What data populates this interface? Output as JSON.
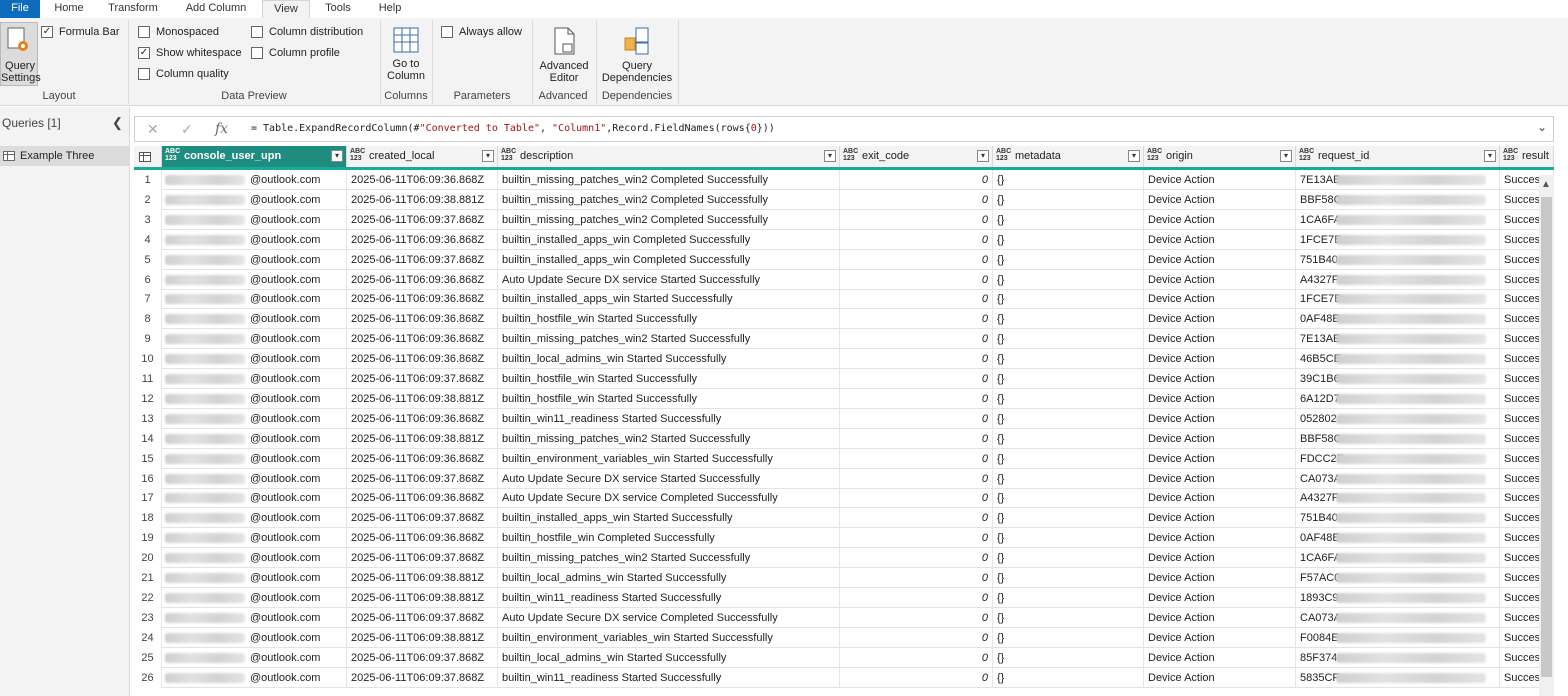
{
  "menu": {
    "tabs": [
      "File",
      "Home",
      "Transform",
      "Add Column",
      "View",
      "Tools",
      "Help"
    ],
    "active": "View"
  },
  "ribbon": {
    "layout": {
      "query_settings_line1": "Query",
      "query_settings_line2": "Settings",
      "formula_bar": "Formula Bar",
      "formula_bar_checked": true,
      "label": "Layout"
    },
    "data_preview": {
      "monospaced": "Monospaced",
      "show_whitespace": "Show whitespace",
      "column_quality": "Column quality",
      "column_distribution": "Column distribution",
      "column_profile": "Column profile",
      "label": "Data Preview"
    },
    "columns": {
      "go_to_column_line1": "Go to",
      "go_to_column_line2": "Column",
      "label": "Columns"
    },
    "parameters": {
      "always_allow": "Always allow",
      "label": "Parameters"
    },
    "advanced": {
      "advanced_editor_line1": "Advanced",
      "advanced_editor_line2": "Editor",
      "label": "Advanced"
    },
    "dependencies": {
      "query_dependencies_line1": "Query",
      "query_dependencies_line2": "Dependencies",
      "label": "Dependencies"
    }
  },
  "queries": {
    "header": "Queries [1]",
    "items": [
      "Example Three"
    ]
  },
  "formula": {
    "prefix": "= Table.ExpandRecordColumn(#",
    "s1": "\"Converted to Table\"",
    "mid": ", ",
    "s2": "\"Column1\"",
    "rest": ",Record.FieldNames(rows{",
    "zero": "0",
    "end": "}))",
    "fx": "fx"
  },
  "grid": {
    "type_label": "ABC\n123",
    "columns": [
      "console_user_upn",
      "created_local",
      "description",
      "exit_code",
      "metadata",
      "origin",
      "request_id",
      "result"
    ],
    "rows": [
      {
        "upn": "@outlook.com",
        "created": "2025-06-11T06:09:36.868Z",
        "desc": "builtin_missing_patches_win2 Completed Successfully",
        "exit": "0",
        "meta": "{}",
        "origin": "Device Action",
        "req": "7E13AE",
        "result": "Success"
      },
      {
        "upn": "@outlook.com",
        "created": "2025-06-11T06:09:38.881Z",
        "desc": "builtin_missing_patches_win2 Completed Successfully",
        "exit": "0",
        "meta": "{}",
        "origin": "Device Action",
        "req": "BBF58C",
        "result": "Success"
      },
      {
        "upn": "@outlook.com",
        "created": "2025-06-11T06:09:37.868Z",
        "desc": "builtin_missing_patches_win2 Completed Successfully",
        "exit": "0",
        "meta": "{}",
        "origin": "Device Action",
        "req": "1CA6FA",
        "result": "Success"
      },
      {
        "upn": "@outlook.com",
        "created": "2025-06-11T06:09:36.868Z",
        "desc": "builtin_installed_apps_win Completed Successfully",
        "exit": "0",
        "meta": "{}",
        "origin": "Device Action",
        "req": "1FCE7B",
        "result": "Success"
      },
      {
        "upn": "@outlook.com",
        "created": "2025-06-11T06:09:37.868Z",
        "desc": "builtin_installed_apps_win Completed Successfully",
        "exit": "0",
        "meta": "{}",
        "origin": "Device Action",
        "req": "751B40",
        "result": "Success"
      },
      {
        "upn": "@outlook.com",
        "created": "2025-06-11T06:09:36.868Z",
        "desc": "Auto Update Secure DX service Started Successfully",
        "exit": "0",
        "meta": "{}",
        "origin": "Device Action",
        "req": "A4327F",
        "result": "Success"
      },
      {
        "upn": "@outlook.com",
        "created": "2025-06-11T06:09:36.868Z",
        "desc": "builtin_installed_apps_win Started Successfully",
        "exit": "0",
        "meta": "{}",
        "origin": "Device Action",
        "req": "1FCE7B",
        "result": "Success"
      },
      {
        "upn": "@outlook.com",
        "created": "2025-06-11T06:09:36.868Z",
        "desc": "builtin_hostfile_win Started Successfully",
        "exit": "0",
        "meta": "{}",
        "origin": "Device Action",
        "req": "0AF48E",
        "result": "Success"
      },
      {
        "upn": "@outlook.com",
        "created": "2025-06-11T06:09:36.868Z",
        "desc": "builtin_missing_patches_win2 Started Successfully",
        "exit": "0",
        "meta": "{}",
        "origin": "Device Action",
        "req": "7E13AE",
        "result": "Success"
      },
      {
        "upn": "@outlook.com",
        "created": "2025-06-11T06:09:36.868Z",
        "desc": "builtin_local_admins_win Started Successfully",
        "exit": "0",
        "meta": "{}",
        "origin": "Device Action",
        "req": "46B5CE",
        "result": "Success"
      },
      {
        "upn": "@outlook.com",
        "created": "2025-06-11T06:09:37.868Z",
        "desc": "builtin_hostfile_win Started Successfully",
        "exit": "0",
        "meta": "{}",
        "origin": "Device Action",
        "req": "39C1B6",
        "result": "Success"
      },
      {
        "upn": "@outlook.com",
        "created": "2025-06-11T06:09:38.881Z",
        "desc": "builtin_hostfile_win Started Successfully",
        "exit": "0",
        "meta": "{}",
        "origin": "Device Action",
        "req": "6A12D7",
        "result": "Success"
      },
      {
        "upn": "@outlook.com",
        "created": "2025-06-11T06:09:36.868Z",
        "desc": "builtin_win11_readiness Started Successfully",
        "exit": "0",
        "meta": "{}",
        "origin": "Device Action",
        "req": "052802",
        "result": "Success"
      },
      {
        "upn": "@outlook.com",
        "created": "2025-06-11T06:09:38.881Z",
        "desc": "builtin_missing_patches_win2 Started Successfully",
        "exit": "0",
        "meta": "{}",
        "origin": "Device Action",
        "req": "BBF58C",
        "result": "Success"
      },
      {
        "upn": "@outlook.com",
        "created": "2025-06-11T06:09:36.868Z",
        "desc": "builtin_environment_variables_win Started Successfully",
        "exit": "0",
        "meta": "{}",
        "origin": "Device Action",
        "req": "FDCC2E",
        "result": "Success"
      },
      {
        "upn": "@outlook.com",
        "created": "2025-06-11T06:09:37.868Z",
        "desc": "Auto Update Secure DX service Started Successfully",
        "exit": "0",
        "meta": "{}",
        "origin": "Device Action",
        "req": "CA073A",
        "result": "Success"
      },
      {
        "upn": "@outlook.com",
        "created": "2025-06-11T06:09:36.868Z",
        "desc": "Auto Update Secure DX service Completed Successfully",
        "exit": "0",
        "meta": "{}",
        "origin": "Device Action",
        "req": "A4327F",
        "result": "Success"
      },
      {
        "upn": "@outlook.com",
        "created": "2025-06-11T06:09:37.868Z",
        "desc": "builtin_installed_apps_win Started Successfully",
        "exit": "0",
        "meta": "{}",
        "origin": "Device Action",
        "req": "751B40",
        "result": "Success"
      },
      {
        "upn": "@outlook.com",
        "created": "2025-06-11T06:09:36.868Z",
        "desc": "builtin_hostfile_win Completed Successfully",
        "exit": "0",
        "meta": "{}",
        "origin": "Device Action",
        "req": "0AF48E",
        "result": "Success"
      },
      {
        "upn": "@outlook.com",
        "created": "2025-06-11T06:09:37.868Z",
        "desc": "builtin_missing_patches_win2 Started Successfully",
        "exit": "0",
        "meta": "{}",
        "origin": "Device Action",
        "req": "1CA6FA",
        "result": "Success"
      },
      {
        "upn": "@outlook.com",
        "created": "2025-06-11T06:09:38.881Z",
        "desc": "builtin_local_admins_win Started Successfully",
        "exit": "0",
        "meta": "{}",
        "origin": "Device Action",
        "req": "F57AC0",
        "result": "Success"
      },
      {
        "upn": "@outlook.com",
        "created": "2025-06-11T06:09:38.881Z",
        "desc": "builtin_win11_readiness Started Successfully",
        "exit": "0",
        "meta": "{}",
        "origin": "Device Action",
        "req": "1893C9",
        "result": "Success"
      },
      {
        "upn": "@outlook.com",
        "created": "2025-06-11T06:09:37.868Z",
        "desc": "Auto Update Secure DX service Completed Successfully",
        "exit": "0",
        "meta": "{}",
        "origin": "Device Action",
        "req": "CA073A",
        "result": "Success"
      },
      {
        "upn": "@outlook.com",
        "created": "2025-06-11T06:09:38.881Z",
        "desc": "builtin_environment_variables_win Started Successfully",
        "exit": "0",
        "meta": "{}",
        "origin": "Device Action",
        "req": "F0084E",
        "result": "Success"
      },
      {
        "upn": "@outlook.com",
        "created": "2025-06-11T06:09:37.868Z",
        "desc": "builtin_local_admins_win Started Successfully",
        "exit": "0",
        "meta": "{}",
        "origin": "Device Action",
        "req": "85F374",
        "result": "Success"
      },
      {
        "upn": "@outlook.com",
        "created": "2025-06-11T06:09:37.868Z",
        "desc": "builtin_win11_readiness Started Successfully",
        "exit": "0",
        "meta": "{}",
        "origin": "Device Action",
        "req": "5835CF",
        "result": "Success"
      }
    ]
  },
  "colors": {
    "accent": "#0f6cbd",
    "header_underline": "#1aa99a",
    "selected_header": "#1f8c80"
  }
}
